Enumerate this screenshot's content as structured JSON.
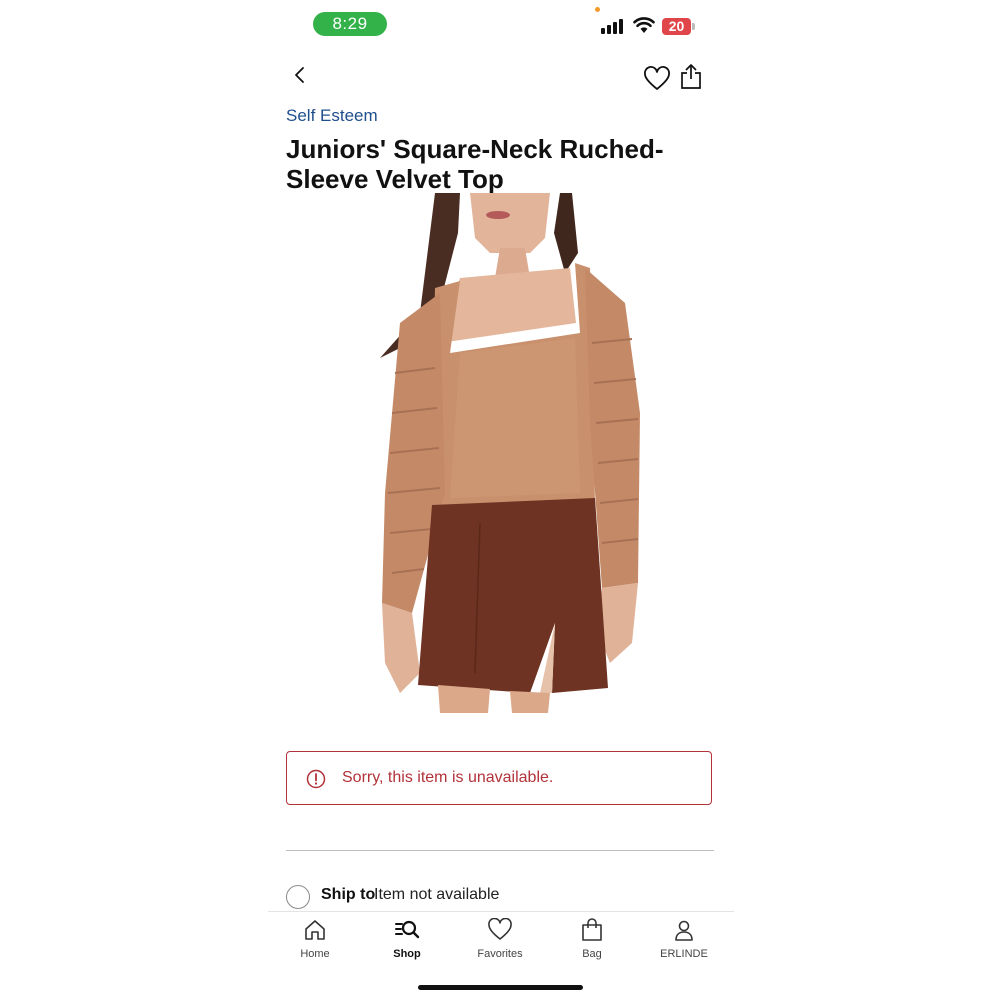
{
  "status_bar": {
    "time": "8:29",
    "battery": "20",
    "icons": [
      "signal-icon",
      "wifi-icon",
      "battery-icon"
    ]
  },
  "header": {
    "icons": [
      "back-chevron-icon",
      "heart-icon",
      "share-icon"
    ]
  },
  "product": {
    "brand": "Self Esteem",
    "title": "Juniors' Square-Neck Ruched-Sleeve Velvet Top",
    "image_icon": "product-photo",
    "top_color": "#c9906d",
    "skirt_color": "#6e3322"
  },
  "alert": {
    "icon": "exclamation-circle-icon",
    "message": "Sorry, this item is unavailable.",
    "color": "#b2323a"
  },
  "shipping": {
    "label": "Ship to",
    "value": "Item not available"
  },
  "bottom_nav": {
    "items": [
      {
        "label": "Home",
        "icon": "home-icon"
      },
      {
        "label": "Shop",
        "icon": "shop-search-icon",
        "active": true
      },
      {
        "label": "Favorites",
        "icon": "heart-icon"
      },
      {
        "label": "Bag",
        "icon": "bag-icon"
      },
      {
        "label": "ERLINDE",
        "icon": "account-icon"
      }
    ]
  },
  "colors": {
    "brand_link": "#1f4e8c",
    "status_time_bg": "#34b24a",
    "battery_low": "#e0454a"
  }
}
